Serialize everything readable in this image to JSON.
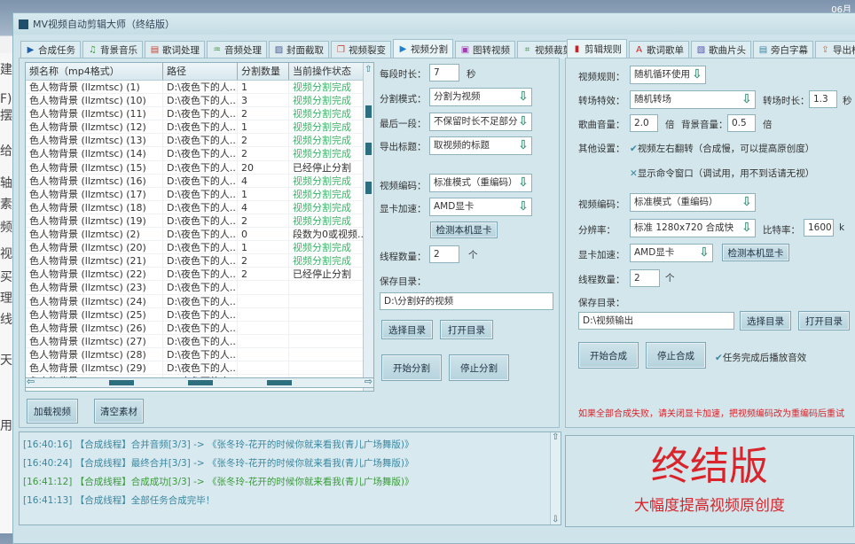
{
  "background_fragments": [
    "建",
    "F)",
    "摆",
    "给",
    "轴",
    "素",
    "频",
    "视",
    "买",
    "理",
    "线",
    "天",
    "用"
  ],
  "clock": "06月",
  "window": {
    "title": "MV视频自动剪辑大师（终结版）"
  },
  "left_tabs": [
    {
      "label": "合成任务",
      "icon": "play-icon"
    },
    {
      "label": "背景音乐",
      "icon": "music-icon"
    },
    {
      "label": "歌词处理",
      "icon": "lyrics-icon"
    },
    {
      "label": "音频处理",
      "icon": "audio-icon"
    },
    {
      "label": "封面截取",
      "icon": "image-icon"
    },
    {
      "label": "视频裂变",
      "icon": "copy-icon"
    },
    {
      "label": "视频分割",
      "icon": "video-icon",
      "active": true
    },
    {
      "label": "图转视频",
      "icon": "slideshow-icon"
    },
    {
      "label": "视频裁剪",
      "icon": "crop-icon"
    }
  ],
  "list": {
    "columns": [
      "频名称（mp4格式）",
      "路径",
      "分割数量",
      "当前操作状态"
    ],
    "rows": [
      [
        "色人物背景 (llzmtsc) (1)",
        "D:\\夜色下的人...",
        "1",
        "视频分割完成"
      ],
      [
        "色人物背景 (llzmtsc) (10)",
        "D:\\夜色下的人...",
        "3",
        "视频分割完成"
      ],
      [
        "色人物背景 (llzmtsc) (11)",
        "D:\\夜色下的人...",
        "2",
        "视频分割完成"
      ],
      [
        "色人物背景 (llzmtsc) (12)",
        "D:\\夜色下的人...",
        "1",
        "视频分割完成"
      ],
      [
        "色人物背景 (llzmtsc) (13)",
        "D:\\夜色下的人...",
        "2",
        "视频分割完成"
      ],
      [
        "色人物背景 (llzmtsc) (14)",
        "D:\\夜色下的人...",
        "2",
        "视频分割完成"
      ],
      [
        "色人物背景 (llzmtsc) (15)",
        "D:\\夜色下的人...",
        "20",
        "已经停止分割"
      ],
      [
        "色人物背景 (llzmtsc) (16)",
        "D:\\夜色下的人...",
        "4",
        "视频分割完成"
      ],
      [
        "色人物背景 (llzmtsc) (17)",
        "D:\\夜色下的人...",
        "1",
        "视频分割完成"
      ],
      [
        "色人物背景 (llzmtsc) (18)",
        "D:\\夜色下的人...",
        "4",
        "视频分割完成"
      ],
      [
        "色人物背景 (llzmtsc) (19)",
        "D:\\夜色下的人...",
        "2",
        "视频分割完成"
      ],
      [
        "色人物背景 (llzmtsc) (2)",
        "D:\\夜色下的人...",
        "0",
        "段数为0或视频..."
      ],
      [
        "色人物背景 (llzmtsc) (20)",
        "D:\\夜色下的人...",
        "1",
        "视频分割完成"
      ],
      [
        "色人物背景 (llzmtsc) (21)",
        "D:\\夜色下的人...",
        "2",
        "视频分割完成"
      ],
      [
        "色人物背景 (llzmtsc) (22)",
        "D:\\夜色下的人...",
        "2",
        "已经停止分割"
      ],
      [
        "色人物背景 (llzmtsc) (23)",
        "D:\\夜色下的人...",
        "",
        ""
      ],
      [
        "色人物背景 (llzmtsc) (24)",
        "D:\\夜色下的人...",
        "",
        ""
      ],
      [
        "色人物背景 (llzmtsc) (25)",
        "D:\\夜色下的人...",
        "",
        ""
      ],
      [
        "色人物背景 (llzmtsc) (26)",
        "D:\\夜色下的人...",
        "",
        ""
      ],
      [
        "色人物背景 (llzmtsc) (27)",
        "D:\\夜色下的人...",
        "",
        ""
      ],
      [
        "色人物背景 (llzmtsc) (28)",
        "D:\\夜色下的人...",
        "",
        ""
      ],
      [
        "色人物背景 (llzmtsc) (29)",
        "D:\\夜色下的人...",
        "",
        ""
      ],
      [
        "色人物背景 (llzmtsc) (3)",
        "D:\\夜色下的人...",
        "",
        ""
      ]
    ]
  },
  "list_buttons": {
    "load": "加载视频",
    "clear": "清空素材"
  },
  "split": {
    "seg_label": "每段时长：",
    "seg_value": "7",
    "seg_unit": "秒",
    "mode_label": "分割模式：",
    "mode_value": "分割为视频",
    "last_label": "最后一段：",
    "last_value": "不保留时长不足部分",
    "title_label": "导出标题：",
    "title_value": "取视频的标题",
    "enc_label": "视频编码：",
    "enc_value": "标准模式（重编码）",
    "gpu_label": "显卡加速：",
    "gpu_value": "AMD显卡",
    "detect": "检测本机显卡",
    "thread_label": "线程数量：",
    "thread_value": "2",
    "thread_unit": "个",
    "dir_label": "保存目录：",
    "dir_value": "D:\\分割好的视频",
    "choose": "选择目录",
    "open": "打开目录",
    "start": "开始分割",
    "stop": "停止分割"
  },
  "right_tabs": [
    {
      "label": "剪辑规则",
      "icon": "film-icon",
      "active": true
    },
    {
      "label": "歌词歌单",
      "icon": "font-icon"
    },
    {
      "label": "歌曲片头",
      "icon": "picture-icon"
    },
    {
      "label": "旁白字幕",
      "icon": "document-icon"
    },
    {
      "label": "导出标题",
      "icon": "export-icon"
    }
  ],
  "rules": {
    "video_rule_label": "视频规则：",
    "video_rule_value": "随机循环使用",
    "trans_label": "转场特效：",
    "trans_value": "随机转场",
    "trans_dur_label": "转场时长：",
    "trans_dur_value": "1.3",
    "trans_dur_unit": "秒",
    "song_vol_label": "歌曲音量：",
    "song_vol_value": "2.0",
    "song_vol_unit": "倍",
    "bg_vol_label": "背景音量：",
    "bg_vol_value": "0.5",
    "bg_vol_unit": "倍",
    "other_label": "其他设置：",
    "flip_label": "视频左右翻转（合成慢，可以提高原创度）",
    "flip_checked": true,
    "cmd_label": "显示命令窗口（调试用，用不到话请无视）",
    "cmd_checked": false,
    "enc_label": "视频编码：",
    "enc_value": "标准模式（重编码）",
    "res_label": "分辨率：",
    "res_value": "标准 1280x720  合成快",
    "bitrate_label": "比特率：",
    "bitrate_value": "1600",
    "bitrate_unit": "k",
    "gpu_label": "显卡加速：",
    "gpu_value": "AMD显卡",
    "detect": "检测本机显卡",
    "thread_label": "线程数量：",
    "thread_value": "2",
    "thread_unit": "个",
    "dir_label": "保存目录：",
    "dir_value": "D:\\视频输出",
    "choose": "选择目录",
    "open": "打开目录",
    "start": "开始合成",
    "stop": "停止合成",
    "sound_label": "任务完成后播放音效",
    "sound_checked": true,
    "warning": "如果全部合成失败，请关闭显卡加速，把视频编码改为重编码后重试"
  },
  "log": [
    {
      "text": "[16:40:16] 【合成线程】合并音频[3/3] -> 《张冬玲-花开的时候你就来看我(青儿广场舞版)》",
      "color": "#3a86a0"
    },
    {
      "text": "[16:40:24] 【合成线程】最终合并[3/3] -> 《张冬玲-花开的时候你就来看我(青儿广场舞版)》",
      "color": "#3a86a0"
    },
    {
      "text": "[16:41:12] 【合成线程】合成成功[3/3] -> 《张冬玲-花开的时候你就来看我(青儿广场舞版)》",
      "color": "#3a9a3a"
    },
    {
      "text": "[16:41:13] 【合成线程】全部任务合成完毕！",
      "color": "#3a86a0"
    }
  ],
  "brand": {
    "title": "终结版",
    "subtitle": "大幅度提高视频原创度",
    "color": "#d8242a"
  },
  "colors": {
    "ok": "#3bb36a",
    "accent": "#2e6f7f"
  }
}
